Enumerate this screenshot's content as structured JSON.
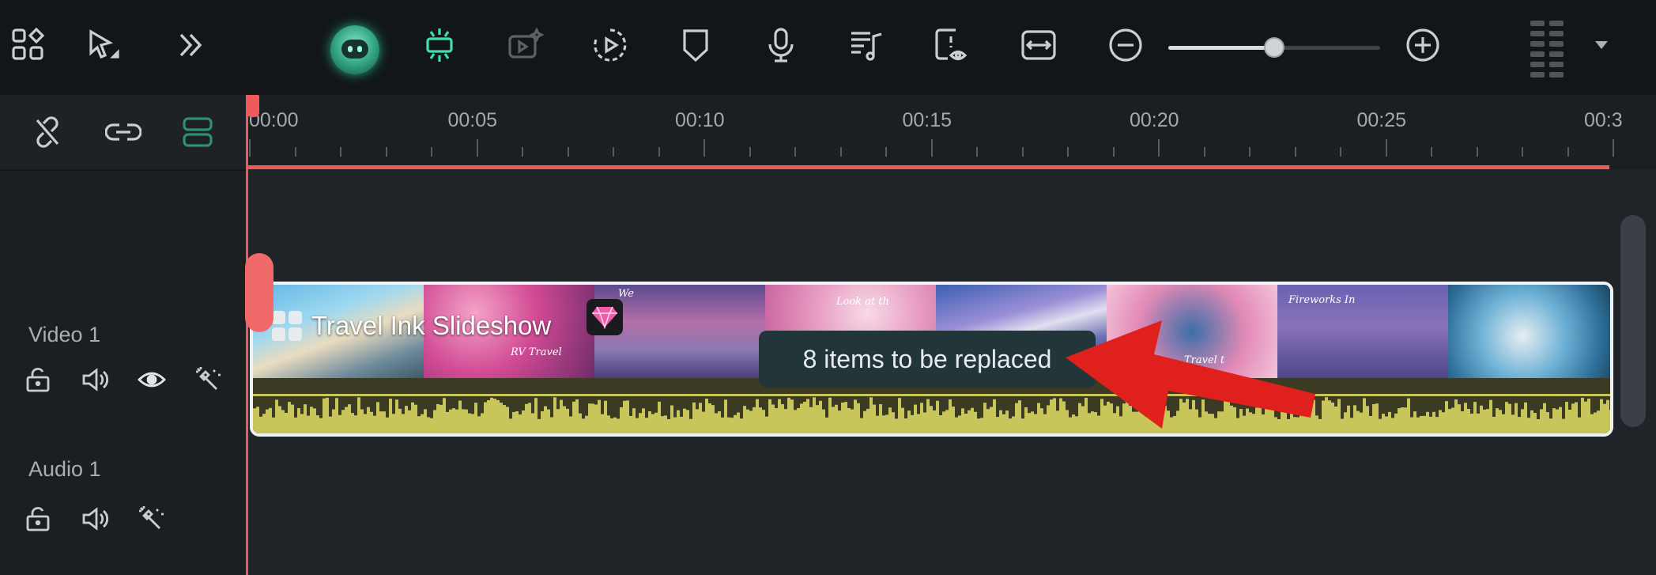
{
  "toolbar": {
    "icons": [
      "apps-grid-icon",
      "select-pointer-icon",
      "more-chevrons-icon",
      "ai-assistant-icon",
      "auto-highlight-icon",
      "ai-video-icon",
      "play-cycle-icon",
      "marker-shield-icon",
      "microphone-icon",
      "music-list-icon",
      "preview-eye-icon",
      "fit-arrows-icon",
      "zoom-out-icon",
      "zoom-in-icon"
    ],
    "zoom_level": 0.5,
    "accent_color": "#3ee0b0"
  },
  "left_panel": {
    "top_icons": [
      "unlink-icon",
      "link-icon",
      "snap-icon"
    ],
    "tracks": [
      {
        "label": "Video 1",
        "controls": [
          "lock-icon",
          "volume-icon",
          "visibility-eye-icon",
          "effects-wand-icon"
        ]
      },
      {
        "label": "Audio 1",
        "controls": [
          "lock-icon",
          "volume-icon",
          "effects-wand-icon"
        ]
      }
    ]
  },
  "ruler": {
    "labels": [
      "00:00",
      "00:05",
      "00:10",
      "00:15",
      "00:20",
      "00:25",
      "00:3"
    ],
    "playhead_color": "#f05a5a"
  },
  "clip": {
    "title": "Travel Ink Slideshow",
    "thumb_captions": [
      "",
      "RV Travel",
      "We",
      "Look at th",
      "",
      "Travel t",
      "Fireworks In",
      ""
    ],
    "border_color": "#f0f2f3",
    "wave_color": "#c8c55a"
  },
  "tooltip": {
    "text": "8 items to be replaced"
  },
  "annotation": {
    "arrow_color": "#e0201c"
  }
}
